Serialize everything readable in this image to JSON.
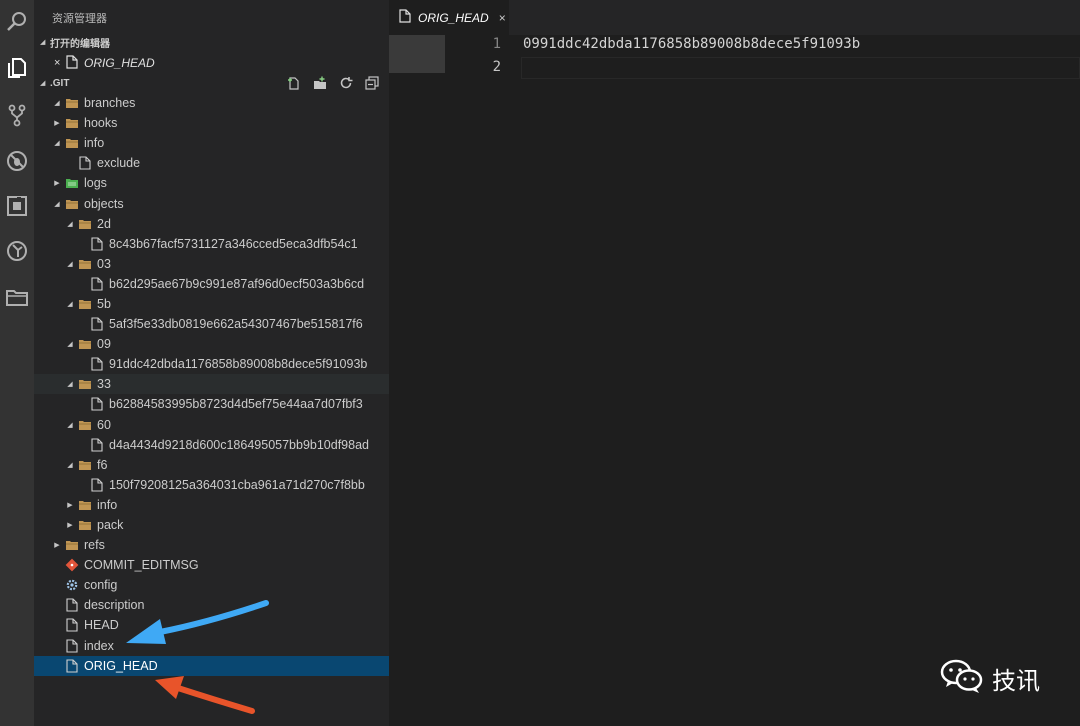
{
  "activity_bar": {
    "icons": [
      "search-icon",
      "files-icon",
      "source-control-icon",
      "debug-icon",
      "extensions-icon",
      "git-history-icon",
      "folder-icon"
    ]
  },
  "sidebar": {
    "title": "资源管理器",
    "open_editors": {
      "header": "打开的编辑器",
      "items": [
        {
          "label": "ORIG_HEAD",
          "close": "×"
        }
      ]
    },
    "git": {
      "header": ".GIT",
      "toolbar": [
        "new-file-icon",
        "new-folder-icon",
        "refresh-icon",
        "collapse-all-icon"
      ],
      "tree": [
        {
          "label": "branches",
          "depth": 1,
          "type": "folder",
          "twisty": "open"
        },
        {
          "label": "hooks",
          "depth": 1,
          "type": "folder",
          "twisty": "closed"
        },
        {
          "label": "info",
          "depth": 1,
          "type": "folder",
          "twisty": "open"
        },
        {
          "label": "exclude",
          "depth": 2,
          "type": "file",
          "twisty": ""
        },
        {
          "label": "logs",
          "depth": 1,
          "type": "folder-green",
          "twisty": "closed"
        },
        {
          "label": "objects",
          "depth": 1,
          "type": "folder",
          "twisty": "open"
        },
        {
          "label": "2d",
          "depth": 2,
          "type": "folder",
          "twisty": "open"
        },
        {
          "label": "8c43b67facf5731127a346cced5eca3dfb54c1",
          "depth": 3,
          "type": "file",
          "twisty": ""
        },
        {
          "label": "03",
          "depth": 2,
          "type": "folder",
          "twisty": "open"
        },
        {
          "label": "b62d295ae67b9c991e87af96d0ecf503a3b6cd",
          "depth": 3,
          "type": "file",
          "twisty": ""
        },
        {
          "label": "5b",
          "depth": 2,
          "type": "folder",
          "twisty": "open"
        },
        {
          "label": "5af3f5e33db0819e662a54307467be515817f6",
          "depth": 3,
          "type": "file",
          "twisty": ""
        },
        {
          "label": "09",
          "depth": 2,
          "type": "folder",
          "twisty": "open"
        },
        {
          "label": "91ddc42dbda1176858b89008b8dece5f91093b",
          "depth": 3,
          "type": "file",
          "twisty": ""
        },
        {
          "label": "33",
          "depth": 2,
          "type": "folder",
          "twisty": "open",
          "state": "hover"
        },
        {
          "label": "b62884583995b8723d4d5ef75e44aa7d07fbf3",
          "depth": 3,
          "type": "file",
          "twisty": ""
        },
        {
          "label": "60",
          "depth": 2,
          "type": "folder",
          "twisty": "open"
        },
        {
          "label": "d4a4434d9218d600c186495057bb9b10df98ad",
          "depth": 3,
          "type": "file",
          "twisty": ""
        },
        {
          "label": "f6",
          "depth": 2,
          "type": "folder",
          "twisty": "open"
        },
        {
          "label": "150f79208125a364031cba961a71d270c7f8bb",
          "depth": 3,
          "type": "file",
          "twisty": ""
        },
        {
          "label": "info",
          "depth": 2,
          "type": "folder",
          "twisty": "closed"
        },
        {
          "label": "pack",
          "depth": 2,
          "type": "folder",
          "twisty": "closed"
        },
        {
          "label": "refs",
          "depth": 1,
          "type": "folder",
          "twisty": "closed"
        },
        {
          "label": "COMMIT_EDITMSG",
          "depth": 1,
          "type": "git-file",
          "twisty": ""
        },
        {
          "label": "config",
          "depth": 1,
          "type": "gear-file",
          "twisty": ""
        },
        {
          "label": "description",
          "depth": 1,
          "type": "file",
          "twisty": ""
        },
        {
          "label": "HEAD",
          "depth": 1,
          "type": "file",
          "twisty": ""
        },
        {
          "label": "index",
          "depth": 1,
          "type": "file",
          "twisty": ""
        },
        {
          "label": "ORIG_HEAD",
          "depth": 1,
          "type": "file",
          "twisty": "",
          "state": "selected"
        }
      ]
    }
  },
  "editor": {
    "tab": {
      "label": "ORIG_HEAD",
      "close": "×"
    },
    "line_numbers": [
      "1",
      "2"
    ],
    "lines": [
      "0991ddc42dbda1176858b89008b8dece5f91093b",
      ""
    ]
  },
  "watermark": {
    "text": "技讯"
  },
  "colors": {
    "arrow_blue": "#3fa9f5",
    "arrow_orange": "#e8542a",
    "selection": "#094771"
  }
}
